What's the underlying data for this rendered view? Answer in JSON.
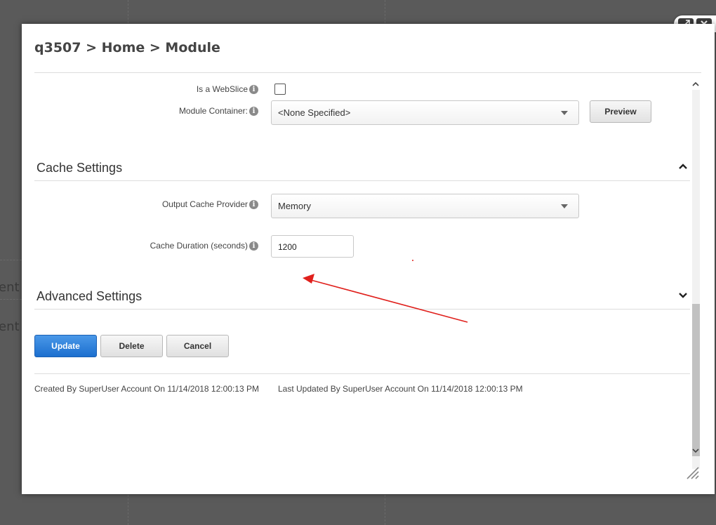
{
  "dialog": {
    "breadcrumb": "q3507 > Home > Module"
  },
  "window_controls": {
    "maximize_icon": "expand-arrows-icon",
    "close_icon": "close-x-icon"
  },
  "module_settings": {
    "webslice_label": "Is a WebSlice",
    "webslice_checked": false,
    "container_label": "Module Container:",
    "container_value": "<None Specified>",
    "preview_label": "Preview"
  },
  "cache_settings": {
    "section_title": "Cache Settings",
    "provider_label": "Output Cache Provider",
    "provider_value": "Memory",
    "duration_label": "Cache Duration (seconds)",
    "duration_value": "1200"
  },
  "advanced_settings": {
    "section_title": "Advanced Settings"
  },
  "actions": {
    "update_label": "Update",
    "delete_label": "Delete",
    "cancel_label": "Cancel"
  },
  "audit": {
    "created": "Created By SuperUser Account On 11/14/2018 12:00:13 PM",
    "updated": "Last Updated By SuperUser Account On 11/14/2018 12:00:13 PM"
  },
  "annotation": {
    "arrow_color": "#e0201c"
  },
  "background": {
    "text_1": "ent",
    "text_2": "ent"
  }
}
